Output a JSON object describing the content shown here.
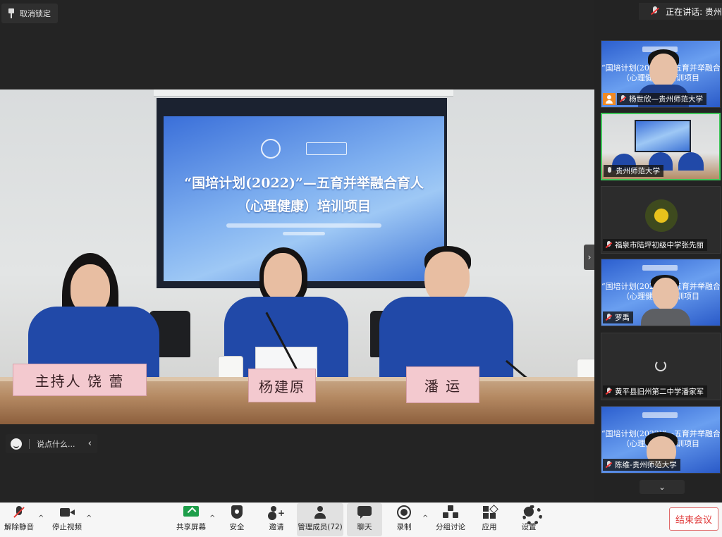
{
  "stage": {
    "unpin_label": "取消锁定",
    "slide": {
      "title_line1": "“国培计划(2022)”—五育并举融合育人",
      "title_line2": "（心理健康）培训项目"
    },
    "nameplates": {
      "host": "主持人 饶 蕾",
      "center": "杨建原",
      "right": "潘 运"
    },
    "chat_placeholder": "说点什么..."
  },
  "right_panel": {
    "speaking_label": "正在讲话: 贵州",
    "tiles": [
      {
        "name": "杨世欣—贵州师范大学",
        "slide_text": "“国培计划(2022)”—五育并举融合育人\n（心理健康）培训项目",
        "host": true,
        "muted": true
      },
      {
        "name": "贵州师范大学",
        "active": true,
        "muted": false
      },
      {
        "name": "福泉市陆坪初级中学张先丽",
        "muted": true
      },
      {
        "name": "罗禹",
        "slide_text": "“国培计划(2022)”—五育并举融合育人\n（心理健康）培训项目",
        "muted": true
      },
      {
        "name": "黄平县旧州第二中学潘家军",
        "muted": true
      },
      {
        "name": "陈维-贵州师范大学",
        "slide_text": "“国培计划(2022)”—五育并举融合育人\n（心理健康）培训项目",
        "muted": true
      }
    ]
  },
  "toolbar": {
    "unmute": "解除静音",
    "stop_video": "停止视频",
    "share_screen": "共享屏幕",
    "security": "安全",
    "invite": "邀请",
    "participants": "管理成员(72)",
    "chat": "聊天",
    "record": "录制",
    "breakout": "分组讨论",
    "apps": "应用",
    "settings": "设置",
    "end_meeting": "结束会议"
  },
  "colors": {
    "accent_green": "#3ec65a",
    "end_red": "#e03c3c",
    "share_green": "#1e9e4a",
    "host_orange": "#f08a24"
  }
}
